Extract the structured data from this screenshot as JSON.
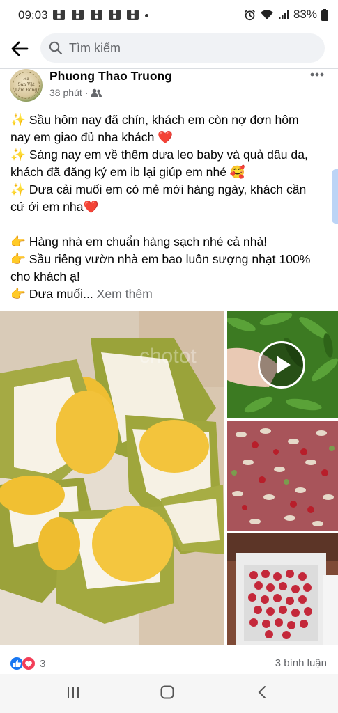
{
  "status_bar": {
    "time": "09:03",
    "battery": "83%",
    "notification_label": "BAO MOI"
  },
  "search": {
    "placeholder": "Tìm kiếm"
  },
  "post": {
    "author": "Phuong Thao Truong",
    "time": "38 phút",
    "avatar_text": [
      "Ha",
      "Sản Vật",
      "Lâm Đồng"
    ],
    "lines": [
      "✨ Sầu hôm nay đã chín, khách em còn nợ đơn hôm",
      "nay em giao đủ nha khách ❤️",
      "✨ Sáng nay em về thêm dưa leo baby và quả dâu da,",
      "khách đã đăng ký em ib lại giúp em nhé 🥰",
      "✨ Dưa cải muối em có mẻ mới hàng ngày, khách cần",
      "cứ ới em nha❤️",
      "",
      "👉 Hàng nhà em chuẩn hàng sạch nhé cả nhà!",
      "👉 Sầu riêng vườn nhà em bao luôn sượng nhạt 100%",
      "cho khách ạ!"
    ],
    "last_line_prefix": "👉 Dưa muối...",
    "see_more": "Xem thêm",
    "watermark": "chotot",
    "reaction_count": "3",
    "comment_count": "3 bình luận"
  },
  "colors": {
    "accent": "#1877f2",
    "love": "#f33e58",
    "muted": "#65676b"
  }
}
